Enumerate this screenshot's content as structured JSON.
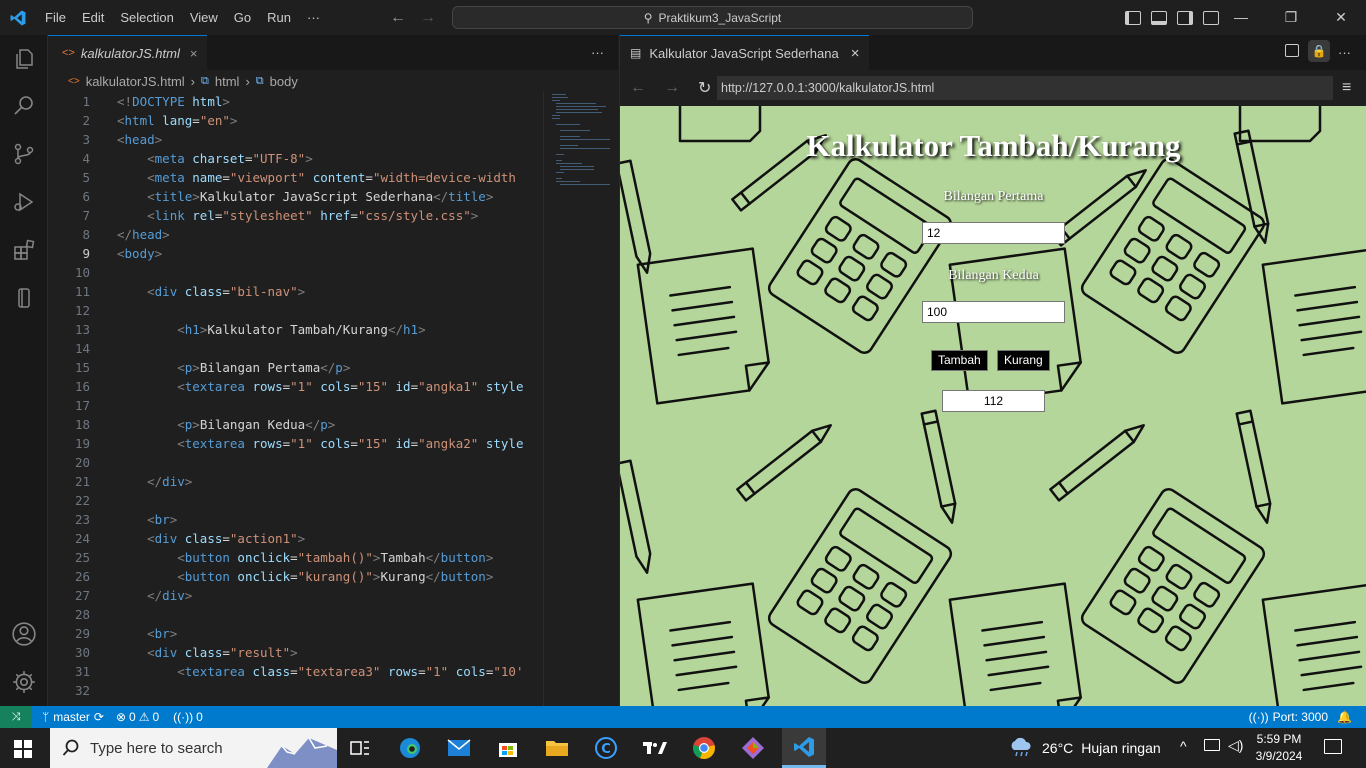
{
  "titlebar": {
    "menus": [
      "File",
      "Edit",
      "Selection",
      "View",
      "Go",
      "Run"
    ],
    "more": "···",
    "search_text": "Praktikum3_JavaScript"
  },
  "window": {
    "minimize": "—",
    "restore": "❐",
    "close": "✕"
  },
  "activity": [
    "explorer-icon",
    "search-icon",
    "source-control-icon",
    "run-debug-icon",
    "extensions-icon",
    "remote-icon",
    "account-icon",
    "settings-icon"
  ],
  "editor": {
    "tab_label": "kalkulatorJS.html",
    "tab_close": "×",
    "breadcrumb": [
      "kalkulatorJS.html",
      "html",
      "body"
    ],
    "current_line": 9,
    "lines": [
      {
        "n": "1",
        "parts": [
          [
            "t",
            "<!"
          ],
          [
            "tg",
            "DOCTYPE"
          ],
          [
            "at",
            " html"
          ],
          [
            "t",
            ">"
          ]
        ]
      },
      {
        "n": "2",
        "parts": [
          [
            "t",
            "<"
          ],
          [
            "tg",
            "html"
          ],
          [
            "at",
            " lang"
          ],
          [
            "tx",
            "="
          ],
          [
            "sv",
            "\"en\""
          ],
          [
            "t",
            ">"
          ]
        ]
      },
      {
        "n": "3",
        "parts": [
          [
            "t",
            "<"
          ],
          [
            "tg",
            "head"
          ],
          [
            "t",
            ">"
          ]
        ]
      },
      {
        "n": "4",
        "parts": [
          [
            "tx",
            "    "
          ],
          [
            "t",
            "<"
          ],
          [
            "tg",
            "meta"
          ],
          [
            "at",
            " charset"
          ],
          [
            "tx",
            "="
          ],
          [
            "sv",
            "\"UTF-8\""
          ],
          [
            "t",
            ">"
          ]
        ]
      },
      {
        "n": "5",
        "parts": [
          [
            "tx",
            "    "
          ],
          [
            "t",
            "<"
          ],
          [
            "tg",
            "meta"
          ],
          [
            "at",
            " name"
          ],
          [
            "tx",
            "="
          ],
          [
            "sv",
            "\"viewport\""
          ],
          [
            "at",
            " content"
          ],
          [
            "tx",
            "="
          ],
          [
            "sv",
            "\"width=device-width"
          ]
        ]
      },
      {
        "n": "6",
        "parts": [
          [
            "tx",
            "    "
          ],
          [
            "t",
            "<"
          ],
          [
            "tg",
            "title"
          ],
          [
            "t",
            ">"
          ],
          [
            "tx",
            "Kalkulator JavaScript Sederhana"
          ],
          [
            "t",
            "</"
          ],
          [
            "tg",
            "title"
          ],
          [
            "t",
            ">"
          ]
        ]
      },
      {
        "n": "7",
        "parts": [
          [
            "tx",
            "    "
          ],
          [
            "t",
            "<"
          ],
          [
            "tg",
            "link"
          ],
          [
            "at",
            " rel"
          ],
          [
            "tx",
            "="
          ],
          [
            "sv",
            "\"stylesheet\""
          ],
          [
            "at",
            " href"
          ],
          [
            "tx",
            "="
          ],
          [
            "sv",
            "\"css/style.css\""
          ],
          [
            "t",
            ">"
          ]
        ]
      },
      {
        "n": "8",
        "parts": [
          [
            "t",
            "</"
          ],
          [
            "tg",
            "head"
          ],
          [
            "t",
            ">"
          ]
        ]
      },
      {
        "n": "9",
        "parts": [
          [
            "t",
            "<"
          ],
          [
            "tg",
            "body"
          ],
          [
            "t",
            ">"
          ]
        ]
      },
      {
        "n": "10",
        "parts": []
      },
      {
        "n": "11",
        "parts": [
          [
            "tx",
            "    "
          ],
          [
            "t",
            "<"
          ],
          [
            "tg",
            "div"
          ],
          [
            "at",
            " class"
          ],
          [
            "tx",
            "="
          ],
          [
            "sv",
            "\"bil-nav\""
          ],
          [
            "t",
            ">"
          ]
        ]
      },
      {
        "n": "12",
        "parts": []
      },
      {
        "n": "13",
        "parts": [
          [
            "tx",
            "        "
          ],
          [
            "t",
            "<"
          ],
          [
            "tg",
            "h1"
          ],
          [
            "t",
            ">"
          ],
          [
            "tx",
            "Kalkulator Tambah/Kurang"
          ],
          [
            "t",
            "</"
          ],
          [
            "tg",
            "h1"
          ],
          [
            "t",
            ">"
          ]
        ]
      },
      {
        "n": "14",
        "parts": []
      },
      {
        "n": "15",
        "parts": [
          [
            "tx",
            "        "
          ],
          [
            "t",
            "<"
          ],
          [
            "tg",
            "p"
          ],
          [
            "t",
            ">"
          ],
          [
            "tx",
            "Bilangan Pertama"
          ],
          [
            "t",
            "</"
          ],
          [
            "tg",
            "p"
          ],
          [
            "t",
            ">"
          ]
        ]
      },
      {
        "n": "16",
        "parts": [
          [
            "tx",
            "        "
          ],
          [
            "t",
            "<"
          ],
          [
            "tg",
            "textarea"
          ],
          [
            "at",
            " rows"
          ],
          [
            "tx",
            "="
          ],
          [
            "sv",
            "\"1\""
          ],
          [
            "at",
            " cols"
          ],
          [
            "tx",
            "="
          ],
          [
            "sv",
            "\"15\""
          ],
          [
            "at",
            " id"
          ],
          [
            "tx",
            "="
          ],
          [
            "sv",
            "\"angka1\""
          ],
          [
            "at",
            " style"
          ]
        ]
      },
      {
        "n": "17",
        "parts": []
      },
      {
        "n": "18",
        "parts": [
          [
            "tx",
            "        "
          ],
          [
            "t",
            "<"
          ],
          [
            "tg",
            "p"
          ],
          [
            "t",
            ">"
          ],
          [
            "tx",
            "Bilangan Kedua"
          ],
          [
            "t",
            "</"
          ],
          [
            "tg",
            "p"
          ],
          [
            "t",
            ">"
          ]
        ]
      },
      {
        "n": "19",
        "parts": [
          [
            "tx",
            "        "
          ],
          [
            "t",
            "<"
          ],
          [
            "tg",
            "textarea"
          ],
          [
            "at",
            " rows"
          ],
          [
            "tx",
            "="
          ],
          [
            "sv",
            "\"1\""
          ],
          [
            "at",
            " cols"
          ],
          [
            "tx",
            "="
          ],
          [
            "sv",
            "\"15\""
          ],
          [
            "at",
            " id"
          ],
          [
            "tx",
            "="
          ],
          [
            "sv",
            "\"angka2\""
          ],
          [
            "at",
            " style"
          ]
        ]
      },
      {
        "n": "20",
        "parts": []
      },
      {
        "n": "21",
        "parts": [
          [
            "tx",
            "    "
          ],
          [
            "t",
            "</"
          ],
          [
            "tg",
            "div"
          ],
          [
            "t",
            ">"
          ]
        ]
      },
      {
        "n": "22",
        "parts": []
      },
      {
        "n": "23",
        "parts": [
          [
            "tx",
            "    "
          ],
          [
            "t",
            "<"
          ],
          [
            "tg",
            "br"
          ],
          [
            "t",
            ">"
          ]
        ]
      },
      {
        "n": "24",
        "parts": [
          [
            "tx",
            "    "
          ],
          [
            "t",
            "<"
          ],
          [
            "tg",
            "div"
          ],
          [
            "at",
            " class"
          ],
          [
            "tx",
            "="
          ],
          [
            "sv",
            "\"action1\""
          ],
          [
            "t",
            ">"
          ]
        ]
      },
      {
        "n": "25",
        "parts": [
          [
            "tx",
            "        "
          ],
          [
            "t",
            "<"
          ],
          [
            "tg",
            "button"
          ],
          [
            "at",
            " onclick"
          ],
          [
            "tx",
            "="
          ],
          [
            "sv",
            "\"tambah()\""
          ],
          [
            "t",
            ">"
          ],
          [
            "tx",
            "Tambah"
          ],
          [
            "t",
            "</"
          ],
          [
            "tg",
            "button"
          ],
          [
            "t",
            ">"
          ]
        ]
      },
      {
        "n": "26",
        "parts": [
          [
            "tx",
            "        "
          ],
          [
            "t",
            "<"
          ],
          [
            "tg",
            "button"
          ],
          [
            "at",
            " onclick"
          ],
          [
            "tx",
            "="
          ],
          [
            "sv",
            "\"kurang()\""
          ],
          [
            "t",
            ">"
          ],
          [
            "tx",
            "Kurang"
          ],
          [
            "t",
            "</"
          ],
          [
            "tg",
            "button"
          ],
          [
            "t",
            ">"
          ]
        ]
      },
      {
        "n": "27",
        "parts": [
          [
            "tx",
            "    "
          ],
          [
            "t",
            "</"
          ],
          [
            "tg",
            "div"
          ],
          [
            "t",
            ">"
          ]
        ]
      },
      {
        "n": "28",
        "parts": []
      },
      {
        "n": "29",
        "parts": [
          [
            "tx",
            "    "
          ],
          [
            "t",
            "<"
          ],
          [
            "tg",
            "br"
          ],
          [
            "t",
            ">"
          ]
        ]
      },
      {
        "n": "30",
        "parts": [
          [
            "tx",
            "    "
          ],
          [
            "t",
            "<"
          ],
          [
            "tg",
            "div"
          ],
          [
            "at",
            " class"
          ],
          [
            "tx",
            "="
          ],
          [
            "sv",
            "\"result\""
          ],
          [
            "t",
            ">"
          ]
        ]
      },
      {
        "n": "31",
        "parts": [
          [
            "tx",
            "        "
          ],
          [
            "t",
            "<"
          ],
          [
            "tg",
            "textarea"
          ],
          [
            "at",
            " class"
          ],
          [
            "tx",
            "="
          ],
          [
            "sv",
            "\"textarea3\""
          ],
          [
            "at",
            " rows"
          ],
          [
            "tx",
            "="
          ],
          [
            "sv",
            "\"1\""
          ],
          [
            "at",
            " cols"
          ],
          [
            "tx",
            "="
          ],
          [
            "sv",
            "\"10'"
          ]
        ]
      },
      {
        "n": "32",
        "parts": []
      }
    ]
  },
  "browser": {
    "tab_label": "Kalkulator JavaScript Sederhana",
    "tab_close": "×",
    "url": "http://127.0.0.1:3000/kalkulatorJS.html",
    "page": {
      "heading": "Kalkulator Tambah/Kurang",
      "label1": "Bilangan Pertama",
      "value1": "12",
      "label2": "Bilangan Kedua",
      "value2": "100",
      "btn_add": "Tambah",
      "btn_sub": "Kurang",
      "result": "112"
    }
  },
  "status": {
    "branch": "master",
    "errors": "0",
    "warnings": "0",
    "ports": "0",
    "port_text": "Port: 3000"
  },
  "taskbar": {
    "search_placeholder": "Type here to search",
    "temp": "26°C",
    "weather": "Hujan ringan",
    "time": "5:59 PM",
    "date": "3/9/2024"
  },
  "colors": {
    "accent": "#007acc",
    "page_bg": "#b5d69a",
    "editor_bg": "#1f1f1f"
  }
}
